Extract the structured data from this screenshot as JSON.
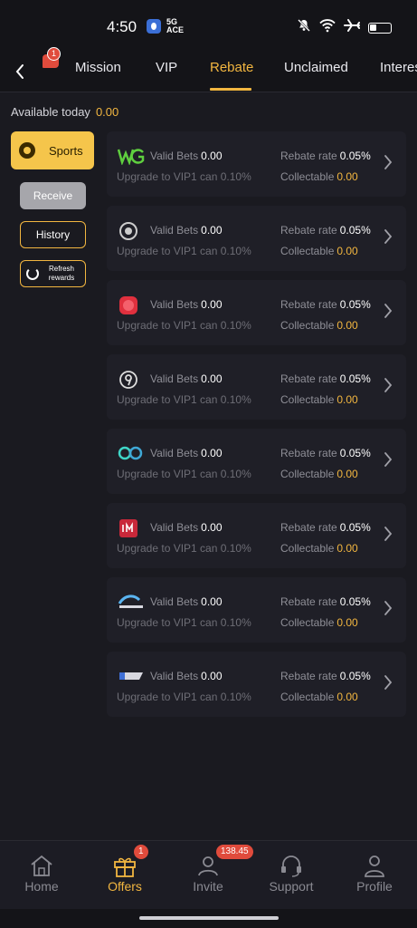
{
  "status": {
    "time": "4:50",
    "net": "5G",
    "net_sub": "ACE"
  },
  "tabs": {
    "chat_badge": "1",
    "items": [
      "Mission",
      "VIP",
      "Rebate",
      "Unclaimed",
      "Interes"
    ],
    "active": "Rebate"
  },
  "available": {
    "label": "Available today",
    "amount": "0.00"
  },
  "sidebar": {
    "sports_label": "Sports",
    "receive_label": "Receive",
    "history_label": "History",
    "refresh_label_1": "Refresh",
    "refresh_label_2": "rewards"
  },
  "cards": [
    {
      "logo": "wg-logo",
      "valid_bets_label": "Valid Bets",
      "valid_bets": "0.00",
      "upgrade_text": "Upgrade to VIP1 can 0.10%",
      "rebate_rate_label": "Rebate rate",
      "rebate_rate": "0.05%",
      "collectable_label": "Collectable",
      "collectable": "0.00"
    },
    {
      "logo": "circle-badge-logo",
      "valid_bets_label": "Valid Bets",
      "valid_bets": "0.00",
      "upgrade_text": "Upgrade to VIP1 can 0.10%",
      "rebate_rate_label": "Rebate rate",
      "rebate_rate": "0.05%",
      "collectable_label": "Collectable",
      "collectable": "0.00"
    },
    {
      "logo": "red-ball-logo",
      "valid_bets_label": "Valid Bets",
      "valid_bets": "0.00",
      "upgrade_text": "Upgrade to VIP1 can 0.10%",
      "rebate_rate_label": "Rebate rate",
      "rebate_rate": "0.05%",
      "collectable_label": "Collectable",
      "collectable": "0.00"
    },
    {
      "logo": "nine-logo",
      "valid_bets_label": "Valid Bets",
      "valid_bets": "0.00",
      "upgrade_text": "Upgrade to VIP1 can 0.10%",
      "rebate_rate_label": "Rebate rate",
      "rebate_rate": "0.05%",
      "collectable_label": "Collectable",
      "collectable": "0.00"
    },
    {
      "logo": "rings-logo",
      "valid_bets_label": "Valid Bets",
      "valid_bets": "0.00",
      "upgrade_text": "Upgrade to VIP1 can 0.10%",
      "rebate_rate_label": "Rebate rate",
      "rebate_rate": "0.05%",
      "collectable_label": "Collectable",
      "collectable": "0.00"
    },
    {
      "logo": "im-logo",
      "valid_bets_label": "Valid Bets",
      "valid_bets": "0.00",
      "upgrade_text": "Upgrade to VIP1 can 0.10%",
      "rebate_rate_label": "Rebate rate",
      "rebate_rate": "0.05%",
      "collectable_label": "Collectable",
      "collectable": "0.00"
    },
    {
      "logo": "wave-logo",
      "valid_bets_label": "Valid Bets",
      "valid_bets": "0.00",
      "upgrade_text": "Upgrade to VIP1 can 0.10%",
      "rebate_rate_label": "Rebate rate",
      "rebate_rate": "0.05%",
      "collectable_label": "Collectable",
      "collectable": "0.00"
    },
    {
      "logo": "flag-logo",
      "valid_bets_label": "Valid Bets",
      "valid_bets": "0.00",
      "upgrade_text": "Upgrade to VIP1 can 0.10%",
      "rebate_rate_label": "Rebate rate",
      "rebate_rate": "0.05%",
      "collectable_label": "Collectable",
      "collectable": "0.00"
    }
  ],
  "nav": {
    "items": [
      {
        "label": "Home",
        "icon": "home-icon"
      },
      {
        "label": "Offers",
        "icon": "gift-icon",
        "badge": "1"
      },
      {
        "label": "Invite",
        "icon": "invite-icon",
        "badge": "138.45"
      },
      {
        "label": "Support",
        "icon": "headset-icon"
      },
      {
        "label": "Profile",
        "icon": "person-icon"
      }
    ],
    "active": "Offers"
  },
  "colors": {
    "accent": "#f2b640",
    "badge": "#e04b3c",
    "background": "#1a1a20",
    "card": "#1f1f27"
  }
}
